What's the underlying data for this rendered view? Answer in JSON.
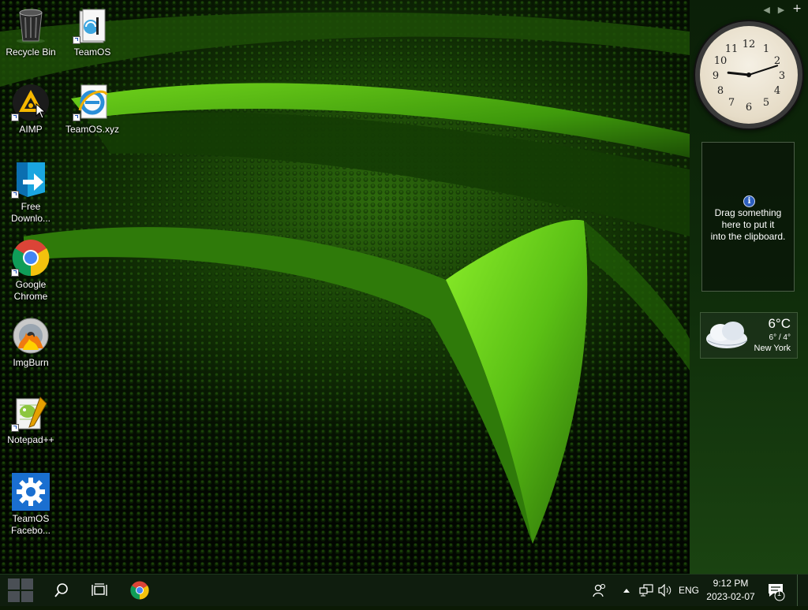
{
  "desktop": {
    "icons": [
      {
        "label": "Recycle Bin",
        "icon": "recycle-bin-icon"
      },
      {
        "label": "TeamOS",
        "icon": "folder-icon"
      },
      {
        "label": "AIMP",
        "icon": "aimp-icon"
      },
      {
        "label": "TeamOS.xyz",
        "icon": "internet-explorer-icon"
      },
      {
        "label": "Free\nDownlo...",
        "icon": "download-arrow-icon"
      },
      {
        "label": "Google\nChrome",
        "icon": "chrome-icon"
      },
      {
        "label": "ImgBurn",
        "icon": "disc-icon"
      },
      {
        "label": "Notepad++",
        "icon": "notepad-icon"
      },
      {
        "label": "TeamOS\nFacebo...",
        "icon": "gear-icon"
      }
    ]
  },
  "sidebar": {
    "controls": {
      "prev": "◀",
      "next": "▶",
      "add": "+"
    },
    "clock": {
      "hour": 9,
      "minute": 12
    },
    "clipboard": {
      "text": "Drag something\nhere to put it\ninto the clipboard.",
      "info_symbol": "i"
    },
    "weather": {
      "temp": "6°C",
      "range": "6° / 4°",
      "city": "New York"
    }
  },
  "taskbar": {
    "buttons": [
      "start-button",
      "search-button",
      "task-view-button",
      "chrome-button"
    ],
    "tray": {
      "lang": "ENG",
      "time": "9:12 PM",
      "date": "2023-02-07",
      "notifications": "1"
    }
  },
  "colors": {
    "taskbar": "#0f1d0e",
    "accent_green": "#7ddc1f",
    "start_blue": "#2a79d8"
  }
}
